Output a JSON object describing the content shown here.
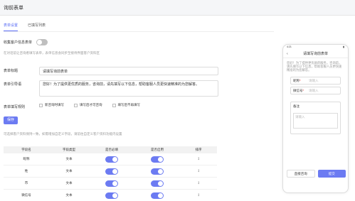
{
  "header": {
    "title": "询前表单"
  },
  "tabs": [
    {
      "label": "表单设置"
    },
    {
      "label": "已填写列表"
    }
  ],
  "collect": {
    "label": "收集客户信息表单",
    "enabled": false
  },
  "collect_hint": "在对话前让咨询者填写表单，表单信息会同步至接待界面客户资料区",
  "form": {
    "title_label": "表单标题",
    "title_value": "请填写询前表单",
    "intro_label": "表单引导语",
    "intro_value": "您好！为了提供更优质的服务，咨询前，请先填写以下信息，帮助客服人员更快速精准的为您解答。",
    "rule_label": "表单填写规则",
    "rules": [
      "新咨询时填写",
      "填写后才可咨询",
      "填写后不再填写"
    ]
  },
  "save_label": "保存",
  "field_hint": "可选择客户资料保持一致，如需增加自定义字段，请前往自定义客户资料功能内设置",
  "table": {
    "headers": [
      "字段名",
      "字段类型",
      "是否必填",
      "是否启用",
      "排序"
    ],
    "rows": [
      {
        "name": "昵称",
        "type": "文本",
        "required": true,
        "enabled": true
      },
      {
        "name": "姓",
        "type": "文本",
        "required": true,
        "enabled": true
      },
      {
        "name": "市",
        "type": "文本",
        "required": true,
        "enabled": true
      },
      {
        "name": "微信号",
        "type": "文本",
        "required": true,
        "enabled": true
      }
    ]
  },
  "preview": {
    "status_time": "4:21",
    "title": "请填写询前表单",
    "intro": "您好！为了提供更优质的服务，咨询前，请先填写以下信息，帮助客服人员更快速精准的为您解答。",
    "fields": [
      {
        "label": "昵称",
        "placeholder": "请输入"
      },
      {
        "label": "微信号",
        "placeholder": "请输入"
      }
    ],
    "remark_label": "备注",
    "remark_placeholder": "请输入",
    "btn_direct": "直接咨询",
    "btn_submit": "提交"
  },
  "colors": {
    "accent": "#6c7bf2"
  }
}
